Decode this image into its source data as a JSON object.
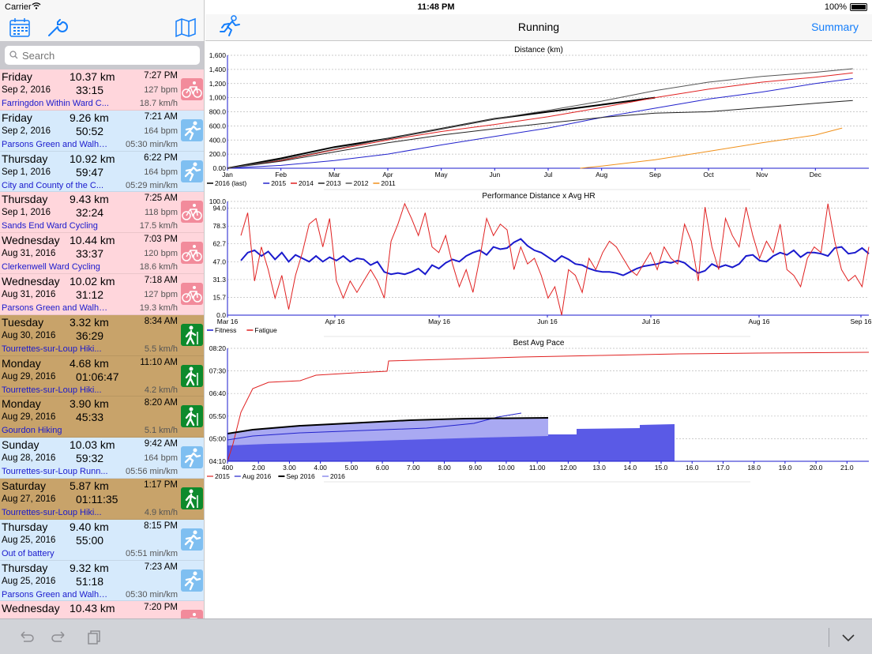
{
  "status": {
    "carrier": "Carrier",
    "time": "11:48 PM",
    "battery": "100%"
  },
  "nav": {
    "title": "Running",
    "summary_label": "Summary"
  },
  "search": {
    "placeholder": "Search"
  },
  "colors": {
    "cycling": "#ffd6dc",
    "running": "#d6eafc",
    "hiking": "#c8a36a",
    "link": "#147efb"
  },
  "activities": [
    {
      "type": "cycling",
      "day": "Friday",
      "distance": "10.37 km",
      "time": "7:27 PM",
      "date": "Sep 2, 2016",
      "duration": "33:15",
      "hr": "127 bpm",
      "location": "Farringdon Within Ward C...",
      "speed": "18.7 km/h",
      "icon": "cycling-icon"
    },
    {
      "type": "running",
      "day": "Friday",
      "distance": "9.26 km",
      "time": "7:21 AM",
      "date": "Sep 2, 2016",
      "duration": "50:52",
      "hr": "164 bpm",
      "location": "Parsons Green and Walham...",
      "speed": "05:30 min/km",
      "icon": "running-icon"
    },
    {
      "type": "running",
      "day": "Thursday",
      "distance": "10.92 km",
      "time": "6:22 PM",
      "date": "Sep 1, 2016",
      "duration": "59:47",
      "hr": "164 bpm",
      "location": "City and County of the C...",
      "speed": "05:29 min/km",
      "icon": "running-icon"
    },
    {
      "type": "cycling",
      "day": "Thursday",
      "distance": "9.43 km",
      "time": "7:25 AM",
      "date": "Sep 1, 2016",
      "duration": "32:24",
      "hr": "118 bpm",
      "location": "Sands End Ward Cycling",
      "speed": "17.5 km/h",
      "icon": "cycling-icon"
    },
    {
      "type": "cycling",
      "day": "Wednesday",
      "distance": "10.44 km",
      "time": "7:03 PM",
      "date": "Aug 31, 2016",
      "duration": "33:37",
      "hr": "120 bpm",
      "location": "Clerkenwell Ward Cycling",
      "speed": "18.6 km/h",
      "icon": "cycling-icon"
    },
    {
      "type": "cycling",
      "day": "Wednesday",
      "distance": "10.02 km",
      "time": "7:18 AM",
      "date": "Aug 31, 2016",
      "duration": "31:12",
      "hr": "127 bpm",
      "location": "Parsons Green and Walham...",
      "speed": "19.3 km/h",
      "icon": "cycling-icon"
    },
    {
      "type": "hiking",
      "day": "Tuesday",
      "distance": "3.32 km",
      "time": "8:34 AM",
      "date": "Aug 30, 2016",
      "duration": "36:29",
      "hr": "",
      "location": "Tourrettes-sur-Loup Hiki...",
      "speed": "5.5 km/h",
      "icon": "hiking-icon"
    },
    {
      "type": "hiking",
      "day": "Monday",
      "distance": "4.68 km",
      "time": "11:10 AM",
      "date": "Aug 29, 2016",
      "duration": "01:06:47",
      "hr": "",
      "location": "Tourrettes-sur-Loup Hiki...",
      "speed": "4.2 km/h",
      "icon": "hiking-icon"
    },
    {
      "type": "hiking",
      "day": "Monday",
      "distance": "3.90 km",
      "time": "8:20 AM",
      "date": "Aug 29, 2016",
      "duration": "45:33",
      "hr": "",
      "location": "Gourdon Hiking",
      "speed": "5.1 km/h",
      "icon": "hiking-icon"
    },
    {
      "type": "running",
      "day": "Sunday",
      "distance": "10.03 km",
      "time": "9:42 AM",
      "date": "Aug 28, 2016",
      "duration": "59:32",
      "hr": "164 bpm",
      "location": "Tourrettes-sur-Loup Runn...",
      "speed": "05:56 min/km",
      "icon": "running-icon"
    },
    {
      "type": "hiking",
      "day": "Saturday",
      "distance": "5.87 km",
      "time": "1:17 PM",
      "date": "Aug 27, 2016",
      "duration": "01:11:35",
      "hr": "",
      "location": "Tourrettes-sur-Loup Hiki...",
      "speed": "4.9 km/h",
      "icon": "hiking-icon"
    },
    {
      "type": "running",
      "day": "Thursday",
      "distance": "9.40 km",
      "time": "8:15 PM",
      "date": "Aug 25, 2016",
      "duration": "55:00",
      "hr": "",
      "location": "Out of battery",
      "speed": "05:51 min/km",
      "icon": "running-icon"
    },
    {
      "type": "running",
      "day": "Thursday",
      "distance": "9.32 km",
      "time": "7:23 AM",
      "date": "Aug 25, 2016",
      "duration": "51:18",
      "hr": "",
      "location": "Parsons Green and Walham...",
      "speed": "05:30 min/km",
      "icon": "running-icon"
    },
    {
      "type": "cycling",
      "day": "Wednesday",
      "distance": "10.43 km",
      "time": "7:20 PM",
      "date": "",
      "duration": "",
      "hr": "",
      "location": "",
      "speed": "",
      "icon": "cycling-icon"
    }
  ],
  "chart_data": [
    {
      "type": "line",
      "title": "Distance (km)",
      "x_categories": [
        "Jan",
        "Feb",
        "Mar",
        "Apr",
        "May",
        "Jun",
        "Jul",
        "Aug",
        "Sep",
        "Oct",
        "Nov",
        "Dec"
      ],
      "y_ticks": [
        "0.00",
        "200.0",
        "400.0",
        "600.0",
        "800.0",
        "1,000",
        "1,200",
        "1,400",
        "1,600"
      ],
      "ylim": [
        0,
        1600
      ],
      "series": [
        {
          "name": "2016 (last)",
          "color": "#000000",
          "width": 2,
          "x": [
            0,
            1,
            2,
            3,
            4,
            5,
            6,
            7,
            8
          ],
          "y": [
            0,
            140,
            300,
            420,
            560,
            700,
            800,
            900,
            1000
          ]
        },
        {
          "name": "2015",
          "color": "#2222cc",
          "width": 1,
          "x": [
            0,
            1,
            2,
            3,
            4,
            5,
            6,
            7,
            8,
            9,
            10,
            11,
            11.7
          ],
          "y": [
            0,
            40,
            110,
            200,
            330,
            450,
            570,
            720,
            850,
            980,
            1080,
            1200,
            1270
          ]
        },
        {
          "name": "2014",
          "color": "#e02020",
          "width": 1,
          "x": [
            0,
            1,
            2,
            3,
            4,
            5,
            6,
            7,
            8,
            9,
            10,
            11,
            11.7
          ],
          "y": [
            0,
            110,
            260,
            400,
            520,
            620,
            730,
            860,
            1000,
            1120,
            1220,
            1290,
            1350
          ]
        },
        {
          "name": "2013",
          "color": "#222222",
          "width": 1,
          "x": [
            0,
            1,
            2,
            3,
            4,
            5,
            6,
            7,
            8,
            9,
            10,
            11,
            11.7
          ],
          "y": [
            0,
            100,
            230,
            360,
            470,
            560,
            640,
            720,
            780,
            800,
            860,
            920,
            960
          ]
        },
        {
          "name": "2012",
          "color": "#555555",
          "width": 1,
          "x": [
            0,
            1,
            2,
            3,
            4,
            5,
            6,
            7,
            8,
            9,
            10,
            11,
            11.7
          ],
          "y": [
            0,
            120,
            270,
            420,
            560,
            700,
            820,
            950,
            1100,
            1220,
            1300,
            1360,
            1410
          ]
        },
        {
          "name": "2011",
          "color": "#f0901a",
          "width": 1,
          "x": [
            6.6,
            7,
            8,
            9,
            10,
            11,
            11.5
          ],
          "y": [
            0,
            30,
            120,
            240,
            360,
            470,
            570
          ]
        }
      ]
    },
    {
      "type": "line",
      "title": "Performance Distance x Avg HR",
      "x_categories": [
        "Mar 16",
        "Apr 16",
        "May 16",
        "Jun 16",
        "Jul 16",
        "Aug 16",
        "Sep 16"
      ],
      "y_ticks": [
        "0.0",
        "15.7",
        "31.3",
        "47.0",
        "62.7",
        "78.3",
        "94.0",
        "100.0"
      ],
      "ylim": [
        0,
        100
      ],
      "series": [
        {
          "name": "Fitness",
          "color": "#1a1acd",
          "width": 2,
          "y": [
            48,
            55,
            57,
            52,
            56,
            49,
            55,
            47,
            53,
            50,
            47,
            52,
            47,
            51,
            48,
            52,
            47,
            50,
            49,
            44,
            47,
            38,
            36,
            37,
            36,
            38,
            41,
            36,
            44,
            41,
            46,
            49,
            47,
            52,
            55,
            57,
            53,
            60,
            58,
            59,
            64,
            67,
            61,
            57,
            55,
            51,
            47,
            52,
            49,
            45,
            44,
            41,
            39,
            38,
            38,
            37,
            35,
            38,
            41,
            43,
            44,
            45,
            47,
            46,
            48,
            46,
            41,
            37,
            39,
            45,
            42,
            44,
            42,
            45,
            52,
            53,
            48,
            47,
            52,
            55,
            53,
            57,
            51,
            55,
            55,
            54,
            52,
            59,
            60,
            54,
            55,
            59,
            54
          ]
        },
        {
          "name": "Fatigue",
          "color": "#e02020",
          "width": 1,
          "y": [
            70,
            90,
            30,
            60,
            40,
            15,
            35,
            5,
            35,
            55,
            80,
            85,
            60,
            85,
            30,
            15,
            30,
            20,
            30,
            40,
            30,
            15,
            65,
            80,
            98,
            85,
            70,
            90,
            60,
            55,
            70,
            45,
            25,
            40,
            20,
            50,
            85,
            70,
            80,
            75,
            40,
            60,
            45,
            50,
            35,
            15,
            25,
            0,
            40,
            35,
            20,
            50,
            40,
            55,
            65,
            60,
            50,
            40,
            35,
            45,
            55,
            40,
            60,
            50,
            45,
            80,
            65,
            30,
            95,
            60,
            40,
            85,
            70,
            60,
            95,
            70,
            50,
            65,
            55,
            80,
            40,
            35,
            25,
            50,
            60,
            55,
            98,
            65,
            40,
            30,
            35,
            25,
            60
          ]
        }
      ]
    },
    {
      "type": "area",
      "title": "Best Avg Pace",
      "x_ticks": [
        "400",
        "2.00",
        "3.00",
        "4.00",
        "5.00",
        "6.00",
        "7.00",
        "8.00",
        "9.00",
        "10.00",
        "11.00",
        "12.00",
        "13.0",
        "14.0",
        "15.0",
        "16.0",
        "17.0",
        "18.0",
        "19.0",
        "20.0",
        "21.0"
      ],
      "y_ticks": [
        "04:10",
        "05:00",
        "05:50",
        "06:40",
        "07:30",
        "08:20"
      ],
      "series": [
        {
          "name": "2015",
          "color": "#e02020",
          "width": 1
        },
        {
          "name": "Aug 2016",
          "color": "#2222cc",
          "width": 1
        },
        {
          "name": "Sep 2016",
          "color": "#000000",
          "width": 2
        },
        {
          "name": "2016",
          "color": "#7070e8",
          "width": 0
        }
      ]
    }
  ]
}
